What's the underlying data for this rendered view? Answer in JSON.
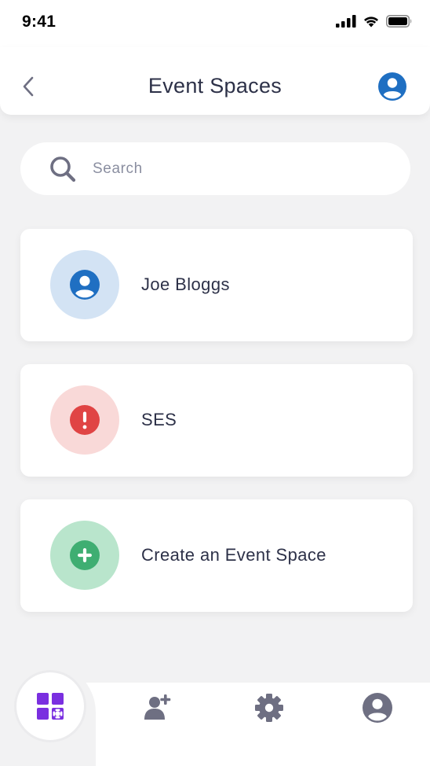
{
  "status_bar": {
    "time": "9:41"
  },
  "header": {
    "title": "Event Spaces",
    "back_icon": "chevron-left-icon",
    "avatar_icon": "user-circle-icon"
  },
  "search": {
    "placeholder": "Search",
    "value": ""
  },
  "spaces": [
    {
      "label": "Joe Bloggs",
      "icon": "user-circle-icon",
      "circle_color": "#d3e3f4",
      "icon_color": "#1f6fc2"
    },
    {
      "label": "SES",
      "icon": "alert-circle-icon",
      "circle_color": "#f9d9d8",
      "icon_color": "#e04444"
    },
    {
      "label": "Create an Event Space",
      "icon": "plus-circle-icon",
      "circle_color": "#b9e5cc",
      "icon_color": "#3fae72"
    }
  ],
  "bottom_nav": {
    "items": [
      {
        "icon": "grid-icon",
        "active": true
      },
      {
        "icon": "add-user-icon",
        "active": false
      },
      {
        "icon": "gear-icon",
        "active": false
      },
      {
        "icon": "profile-icon",
        "active": false
      }
    ],
    "active_color": "#7a2fe0",
    "inactive_color": "#6e6f82"
  }
}
